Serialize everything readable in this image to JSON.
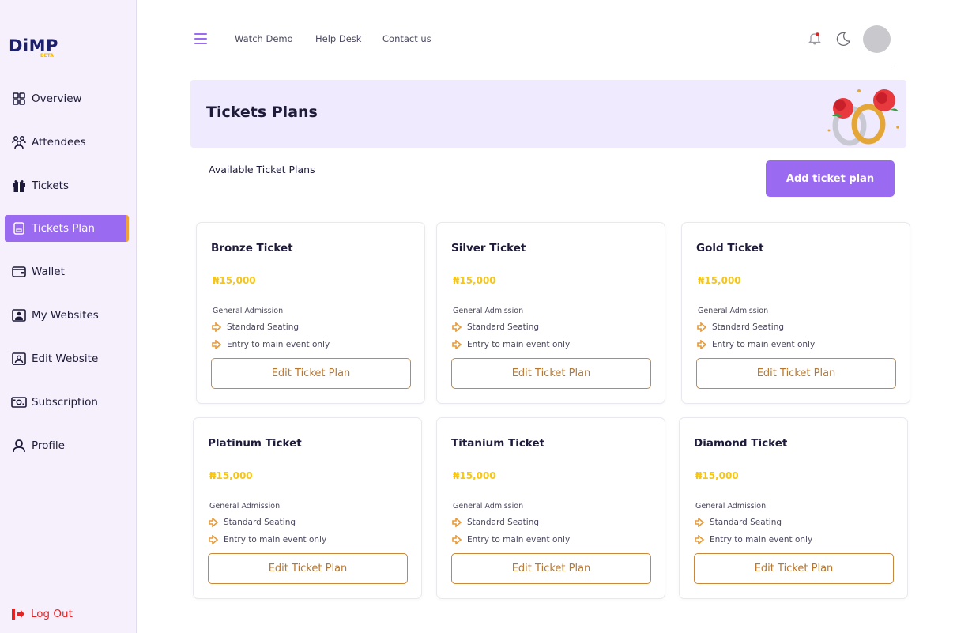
{
  "logo": {
    "text": "DiMP",
    "badge": "BETA"
  },
  "sidebar": {
    "items": [
      {
        "label": "Overview",
        "icon": "grid-icon",
        "active": false
      },
      {
        "label": "Attendees",
        "icon": "users-icon",
        "active": false
      },
      {
        "label": "Tickets",
        "icon": "gift-icon",
        "active": false
      },
      {
        "label": "Tickets Plan",
        "icon": "document-icon",
        "active": true
      },
      {
        "label": "Wallet",
        "icon": "wallet-icon",
        "active": false
      },
      {
        "label": "My Websites",
        "icon": "website-icon",
        "active": false
      },
      {
        "label": "Edit Website",
        "icon": "edit-website-icon",
        "active": false
      },
      {
        "label": "Subscription",
        "icon": "money-icon",
        "active": false
      },
      {
        "label": "Profile",
        "icon": "user-icon",
        "active": false
      }
    ],
    "logout": "Log Out"
  },
  "topbar": {
    "links": [
      "Watch Demo",
      "Help Desk",
      "Contact us"
    ]
  },
  "page": {
    "title": "Tickets Plans",
    "subtitle": "Available Ticket Plans",
    "add_button": "Add ticket plan"
  },
  "cards": [
    {
      "title": "Bronze Ticket",
      "price": "₦15,000",
      "admission": "General Admission",
      "features": [
        "Standard Seating",
        "Entry to main event only"
      ],
      "button": "Edit Ticket Plan"
    },
    {
      "title": "Silver Ticket",
      "price": "₦15,000",
      "admission": "General Admission",
      "features": [
        "Standard Seating",
        "Entry to main event only"
      ],
      "button": "Edit Ticket Plan"
    },
    {
      "title": "Gold Ticket",
      "price": "₦15,000",
      "admission": "General Admission",
      "features": [
        "Standard Seating",
        "Entry to main event only"
      ],
      "button": "Edit Ticket Plan"
    },
    {
      "title": "Platinum Ticket",
      "price": "₦15,000",
      "admission": "General Admission",
      "features": [
        "Standard Seating",
        "Entry to main event only"
      ],
      "button": "Edit Ticket Plan"
    },
    {
      "title": "Titanium Ticket",
      "price": "₦15,000",
      "admission": "General Admission",
      "features": [
        "Standard Seating",
        "Entry to main event only"
      ],
      "button": "Edit Ticket Plan"
    },
    {
      "title": "Diamond Ticket",
      "price": "₦15,000",
      "admission": "General Admission",
      "features": [
        "Standard Seating",
        "Entry to main event only"
      ],
      "button": "Edit Ticket Plan"
    }
  ],
  "colors": {
    "accent": "#9a6bf0",
    "price": "#f5c518",
    "button_border": "#c8883c",
    "logout": "#e02424",
    "sidebar_bg": "#f6effc",
    "banner_bg": "#efeafd"
  }
}
